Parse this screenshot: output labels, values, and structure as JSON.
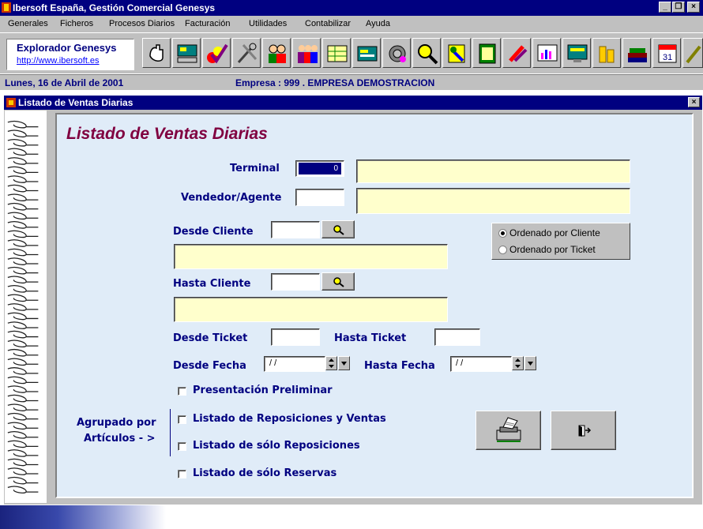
{
  "app": {
    "title": "Ibersoft España, Gestión Comercial Genesys",
    "min": "_",
    "max": "❐",
    "close": "×"
  },
  "menu": [
    "Generales",
    "Ficheros",
    "Procesos Diarios",
    "Facturación",
    "Utilidades",
    "Contabilizar",
    "Ayuda"
  ],
  "explorer": {
    "title": "Explorador Genesys",
    "url": "http://www.ibersoft.es"
  },
  "status": {
    "date": "Lunes, 16 de Abril de 2001",
    "company": "Empresa : 999 . EMPRESA DEMOSTRACION"
  },
  "child": {
    "title": "Listado de Ventas Diarias",
    "close": "×"
  },
  "form": {
    "title": "Listado de Ventas Diarias",
    "terminal_label": "Terminal",
    "terminal_value": "0",
    "vendedor_label": "Vendedor/Agente",
    "desde_cliente_label": "Desde Cliente",
    "hasta_cliente_label": "Hasta Cliente",
    "orden_cliente": "Ordenado por Cliente",
    "orden_ticket": "Ordenado por Ticket",
    "desde_ticket_label": "Desde Ticket",
    "hasta_ticket_label": "Hasta Ticket",
    "desde_fecha_label": "Desde Fecha",
    "desde_fecha_value": "/ /",
    "hasta_fecha_label": "Hasta Fecha",
    "hasta_fecha_value": "/ /",
    "presentacion": "Presentación Preliminar",
    "agrupado_1": "Agrupado por",
    "agrupado_2": "Artículos - >",
    "opt_repos_ventas": "Listado de Reposiciones y Ventas",
    "opt_solo_repos": "Listado de sólo Reposiciones",
    "opt_solo_reservas": "Listado de sólo Reservas"
  },
  "colors": {
    "titlebar": "#000080",
    "panel": "#e0ecf8",
    "formtitle": "#800040",
    "label": "#000080",
    "field": "#ffffcc"
  }
}
